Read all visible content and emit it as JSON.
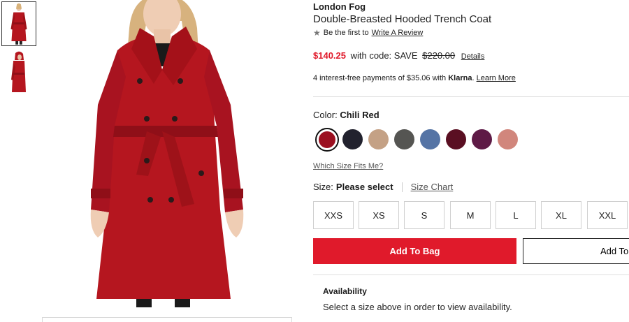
{
  "product": {
    "brand": "London Fog",
    "title": "Double-Breasted Hooded Trench Coat",
    "review_prefix": "Be the first to",
    "review_link": "Write A Review"
  },
  "pricing": {
    "sale_price": "$140.25",
    "code_text": "with code: SAVE",
    "original_price": "$220.00",
    "details_link": "Details",
    "klarna_prefix": "4 interest-free payments of $35.06 with",
    "klarna_brand": "Klarna",
    "klarna_link": "Learn More"
  },
  "color": {
    "label": "Color:",
    "selected": "Chili Red",
    "swatches": [
      {
        "name": "Chili Red",
        "hex": "#9b1020"
      },
      {
        "name": "Navy",
        "hex": "#22222e"
      },
      {
        "name": "Tan",
        "hex": "#c4a185"
      },
      {
        "name": "Gray",
        "hex": "#555552"
      },
      {
        "name": "Blue",
        "hex": "#5574a5"
      },
      {
        "name": "Burgundy",
        "hex": "#5a0f22"
      },
      {
        "name": "Plum",
        "hex": "#5e1a46"
      },
      {
        "name": "Rose",
        "hex": "#d1867c"
      }
    ]
  },
  "size": {
    "which_size_link": "Which Size Fits Me?",
    "label": "Size:",
    "selected": "Please select",
    "chart_link": "Size Chart",
    "options": [
      "XXS",
      "XS",
      "S",
      "M",
      "L",
      "XL",
      "XXL"
    ]
  },
  "actions": {
    "add_to_bag": "Add To Bag",
    "add_to_list": "Add To"
  },
  "availability": {
    "title": "Availability",
    "text": "Select a size above in order to view availability."
  },
  "colors": {
    "accent": "#e01a2b",
    "coat": "#b5161f"
  }
}
